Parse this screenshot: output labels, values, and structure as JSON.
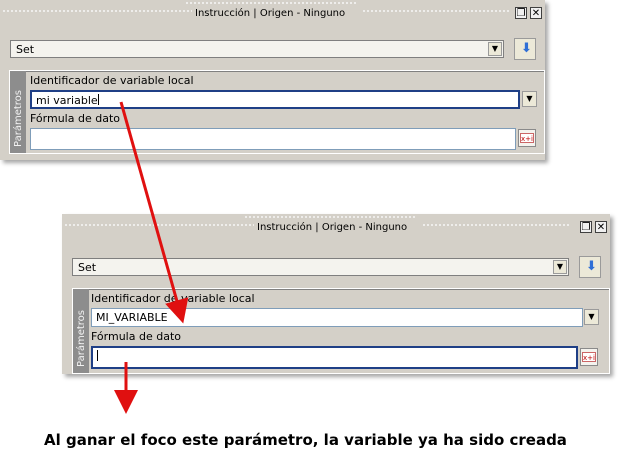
{
  "panel_top": {
    "title": "Instrucción | Origen - Ninguno",
    "instruction_value": "Set",
    "params_tab": "Parámetros",
    "var_id_label": "Identificador de variable local",
    "var_id_value": "mi variable",
    "formula_label": "Fórmula de dato",
    "formula_value": ""
  },
  "panel_bottom": {
    "title": "Instrucción | Origen - Ninguno",
    "instruction_value": "Set",
    "params_tab": "Parámetros",
    "var_id_label": "Identificador de variable local",
    "var_id_value": "MI_VARIABLE",
    "formula_label": "Fórmula de dato",
    "formula_value": ""
  },
  "caption": "Al ganar el foco este parámetro, la variable ya ha sido creada",
  "icons": {
    "restore": "restore-icon",
    "close": "close-icon",
    "dropdown": "chevron-down-icon",
    "move_down": "arrow-down-icon",
    "formula": "formula-icon"
  },
  "colors": {
    "panel_bg": "#d4d0c8",
    "annotation_arrow": "#e01010",
    "focus_border": "#1f3f86",
    "blue_arrow": "#2f6fd6"
  }
}
